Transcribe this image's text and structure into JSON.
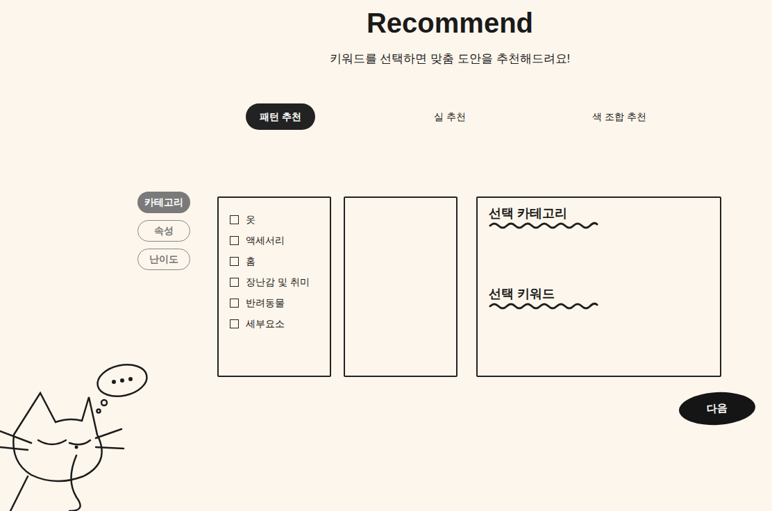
{
  "header": {
    "title": "Recommend",
    "subtitle": "키워드를 선택하면 맞춤 도안을 추천해드려요!"
  },
  "tabs": [
    {
      "label": "패턴 추천",
      "selected": true
    },
    {
      "label": "실 추천",
      "selected": false
    },
    {
      "label": "색 조합 추천",
      "selected": false
    }
  ],
  "filters": [
    {
      "label": "카테고리",
      "selected": true
    },
    {
      "label": "속성",
      "selected": false
    },
    {
      "label": "난이도",
      "selected": false
    }
  ],
  "categories": [
    {
      "label": "옷",
      "checked": false
    },
    {
      "label": "액세서리",
      "checked": false
    },
    {
      "label": "홈",
      "checked": false
    },
    {
      "label": "장난감 및 취미",
      "checked": false
    },
    {
      "label": "반려동물",
      "checked": false
    },
    {
      "label": "세부요소",
      "checked": false
    }
  ],
  "summary": {
    "sections": [
      {
        "title": "선택 카테고리",
        "items": []
      },
      {
        "title": "선택 키워드",
        "items": []
      }
    ]
  },
  "next_button": {
    "label": "다음"
  }
}
